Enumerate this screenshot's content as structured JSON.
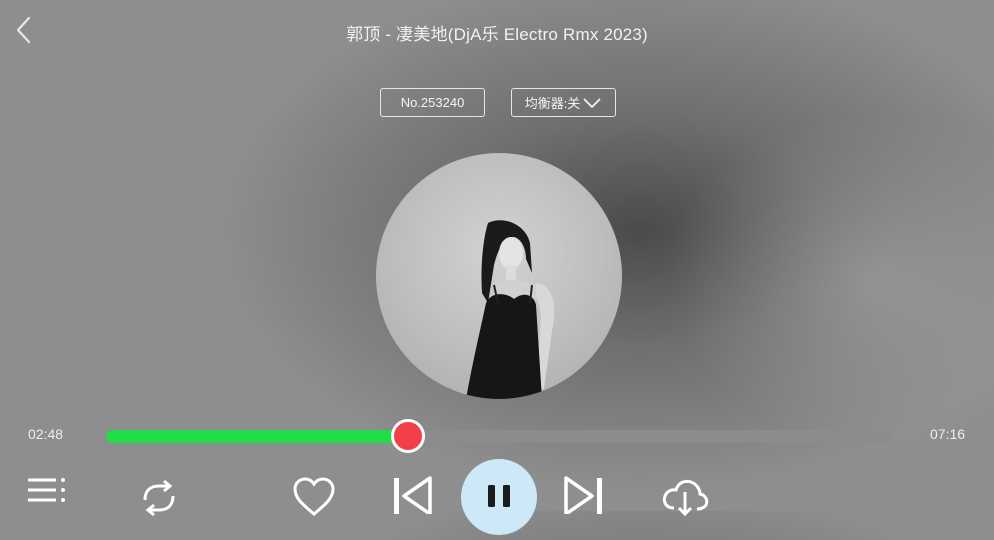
{
  "header": {
    "title": "郭顶 - 凄美地(DjA乐 Electro Rmx 2023)",
    "back_icon": "chevron-left-icon"
  },
  "badges": {
    "song_number": "No.253240",
    "equalizer_label": "均衡器:关",
    "equalizer_icon": "chevron-down-icon"
  },
  "player": {
    "elapsed": "02:48",
    "total": "07:16",
    "progress_fraction": 0.385,
    "progress_color": "#22dd4a",
    "thumb_color": "#f23f48"
  },
  "controls": {
    "icons": [
      "playlist-icon",
      "repeat-icon",
      "heart-icon",
      "previous-icon",
      "pause-icon",
      "next-icon",
      "download-icon"
    ]
  }
}
